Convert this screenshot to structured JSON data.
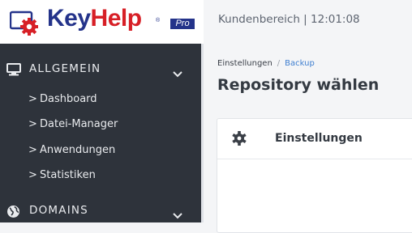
{
  "brand": {
    "name_part1": "Key",
    "name_part2": "Help",
    "registered": "®",
    "edition": "Pro",
    "colors": {
      "blue": "#24338a",
      "red": "#d71f26"
    }
  },
  "header": {
    "info": "Kundenbereich | 12:01:08"
  },
  "sidebar": {
    "background": "#2e333b",
    "sections": [
      {
        "label": "ALLGEMEIN",
        "icon": "monitor-icon",
        "expanded_icon": "chevron-down-icon",
        "items": [
          {
            "label": "Dashboard",
            "arrow": ">"
          },
          {
            "label": "Datei-Manager",
            "arrow": ">"
          },
          {
            "label": "Anwendungen",
            "arrow": ">"
          },
          {
            "label": "Statistiken",
            "arrow": ">"
          }
        ]
      },
      {
        "label": "DOMAINS",
        "icon": "globe-icon",
        "expanded_icon": "chevron-down-icon"
      }
    ]
  },
  "main": {
    "breadcrumb": {
      "items": [
        "Einstellungen",
        "Backup"
      ],
      "separator": "/"
    },
    "title": "Repository wählen",
    "card": {
      "icon": "gear-icon",
      "title": "Einstellungen"
    }
  }
}
